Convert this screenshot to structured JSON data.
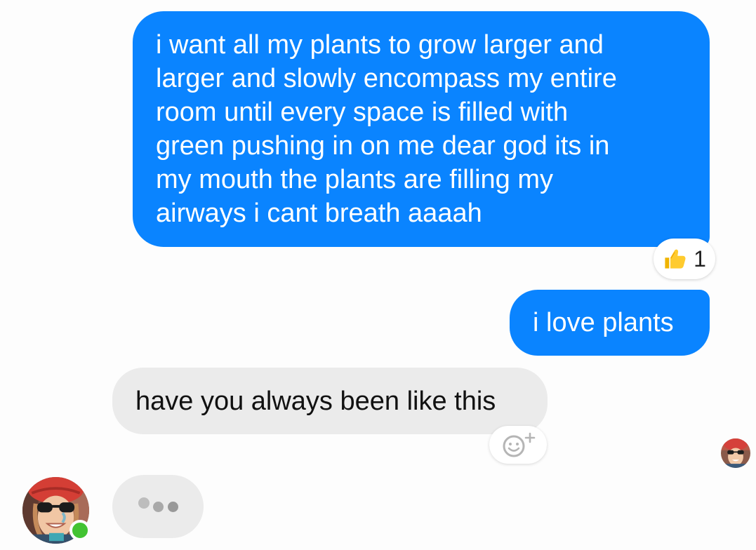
{
  "messages": [
    {
      "direction": "outgoing",
      "text": "i want all my plants to grow larger and\nlarger and slowly encompass my entire\nroom until every space is filled with\ngreen pushing in on me dear god its in\nmy mouth the plants are filling my\nairways i cant breath aaaah",
      "reaction": {
        "icon": "thumbs-up-icon",
        "count": "1"
      }
    },
    {
      "direction": "outgoing",
      "text": "i love plants"
    },
    {
      "direction": "incoming",
      "text": "have you always been like this",
      "react_button_icon": "add-reaction-icon"
    }
  ],
  "typing_indicator": {
    "icon": "typing-dots-icon"
  },
  "contact": {
    "avatar_icon": "avatar",
    "online_status": "online"
  },
  "read_receipt": {
    "icon": "read-receipt-avatar"
  },
  "colors": {
    "outgoing_bubble": "#0a84ff",
    "incoming_bubble": "#ebebeb",
    "online": "#42c332",
    "background": "#fdfdfd"
  }
}
